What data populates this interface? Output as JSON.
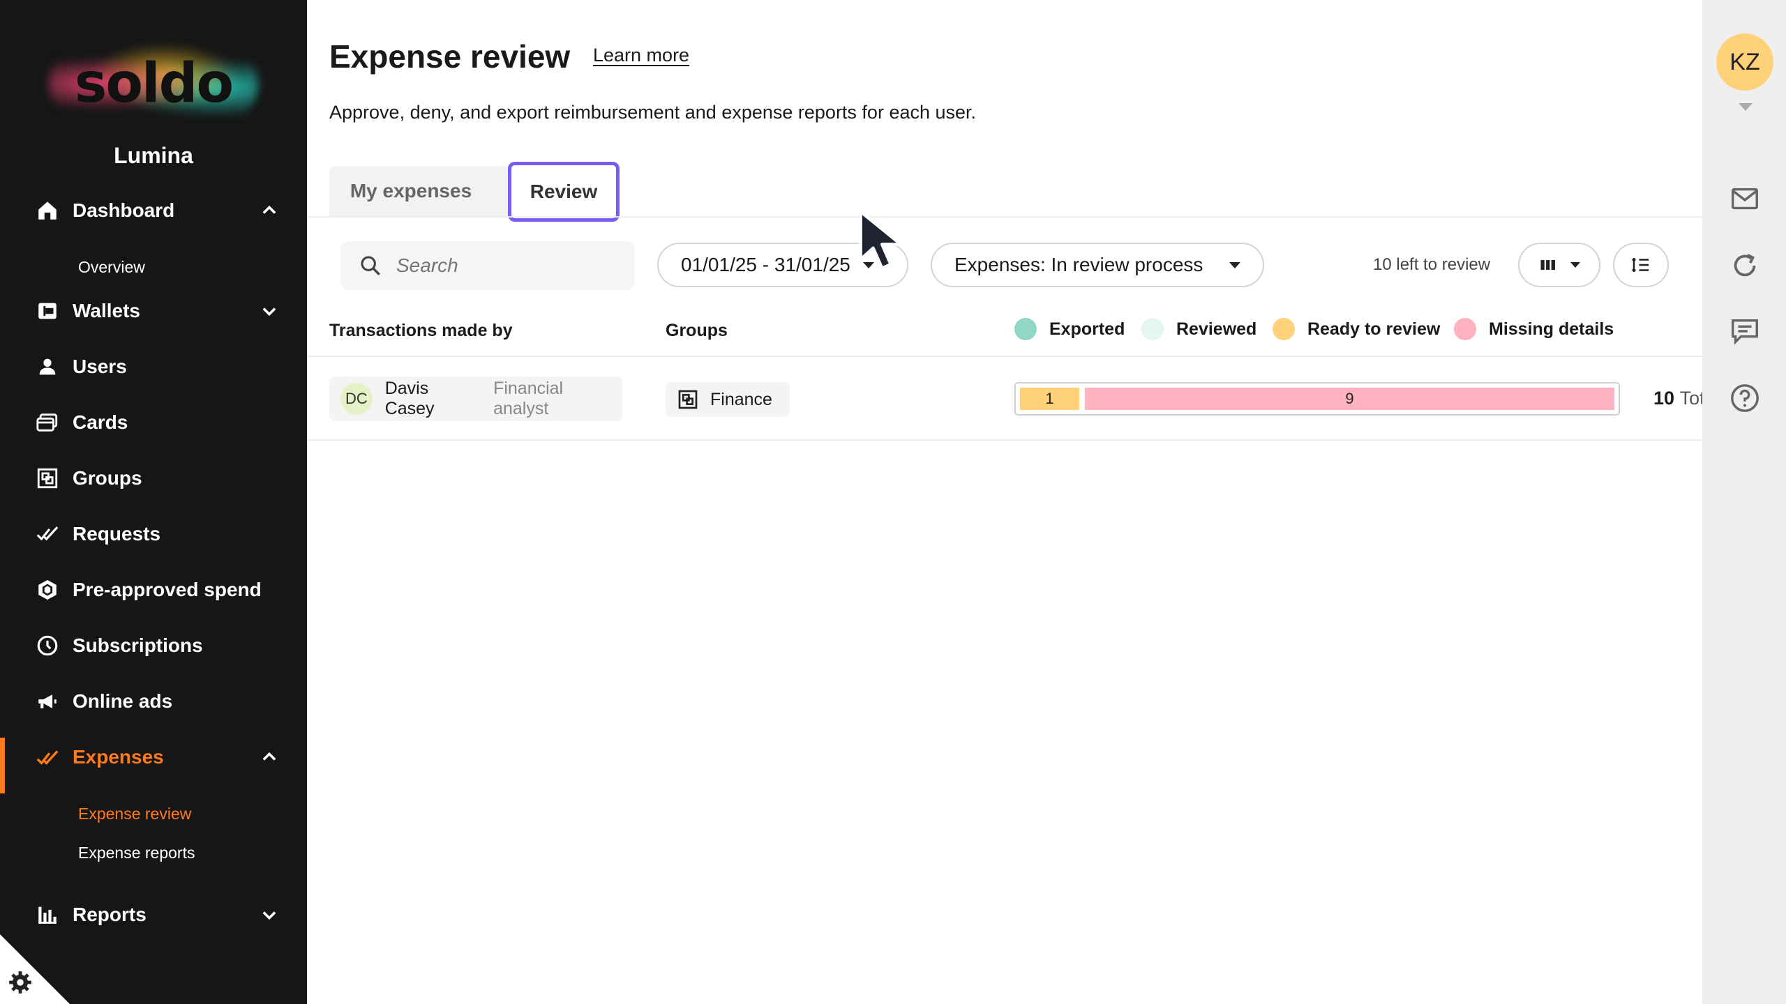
{
  "sidebar": {
    "logo": "soldo",
    "org_name": "Lumina",
    "nav": [
      {
        "label": "Dashboard",
        "icon": "home-icon",
        "expanded": true
      },
      {
        "label": "Wallets",
        "icon": "wallet-icon",
        "expanded": false
      },
      {
        "label": "Users",
        "icon": "user-icon"
      },
      {
        "label": "Cards",
        "icon": "cards-icon"
      },
      {
        "label": "Groups",
        "icon": "groups-icon"
      },
      {
        "label": "Requests",
        "icon": "double-check-icon"
      },
      {
        "label": "Pre-approved spend",
        "icon": "hexagon-icon"
      },
      {
        "label": "Subscriptions",
        "icon": "clock-icon"
      },
      {
        "label": "Online ads",
        "icon": "megaphone-icon"
      },
      {
        "label": "Expenses",
        "icon": "check-icon",
        "expanded": true,
        "active": true
      },
      {
        "label": "Reports",
        "icon": "bar-chart-icon",
        "expanded": false
      }
    ],
    "dashboard_sub": [
      "Overview"
    ],
    "expenses_sub": [
      "Expense review",
      "Expense reports"
    ]
  },
  "header": {
    "title": "Expense review",
    "learn_more": "Learn more",
    "subtitle": "Approve, deny, and export reimbursement and expense reports for each user."
  },
  "tabs": [
    {
      "label": "My expenses",
      "active": false
    },
    {
      "label": "Review",
      "active": true
    }
  ],
  "toolbar": {
    "search_placeholder": "Search",
    "date_range": "01/01/25 - 31/01/25",
    "status_filter": "Expenses: In review process",
    "left_to_review": "10 left to review"
  },
  "table": {
    "headers": {
      "user": "Transactions made by",
      "groups": "Groups"
    },
    "legend": [
      {
        "label": "Exported",
        "color": "#8fd8c6"
      },
      {
        "label": "Reviewed",
        "color": "#e3f6ef"
      },
      {
        "label": "Ready to review",
        "color": "#ffd27a"
      },
      {
        "label": "Missing details",
        "color": "#ffb3c1"
      }
    ],
    "rows": [
      {
        "initials": "DC",
        "name": "Davis Casey",
        "role": "Financial analyst",
        "group": "Finance",
        "ready": 1,
        "missing": 9,
        "total": "10",
        "total_label": "Tot"
      }
    ]
  },
  "rail": {
    "initials": "KZ",
    "icons": [
      "mail-icon",
      "refresh-icon",
      "chat-icon",
      "help-icon"
    ]
  },
  "colors": {
    "accent": "#ff7a1a",
    "tab_focus": "#7a5cf0",
    "sidebar_bg": "#161616"
  }
}
